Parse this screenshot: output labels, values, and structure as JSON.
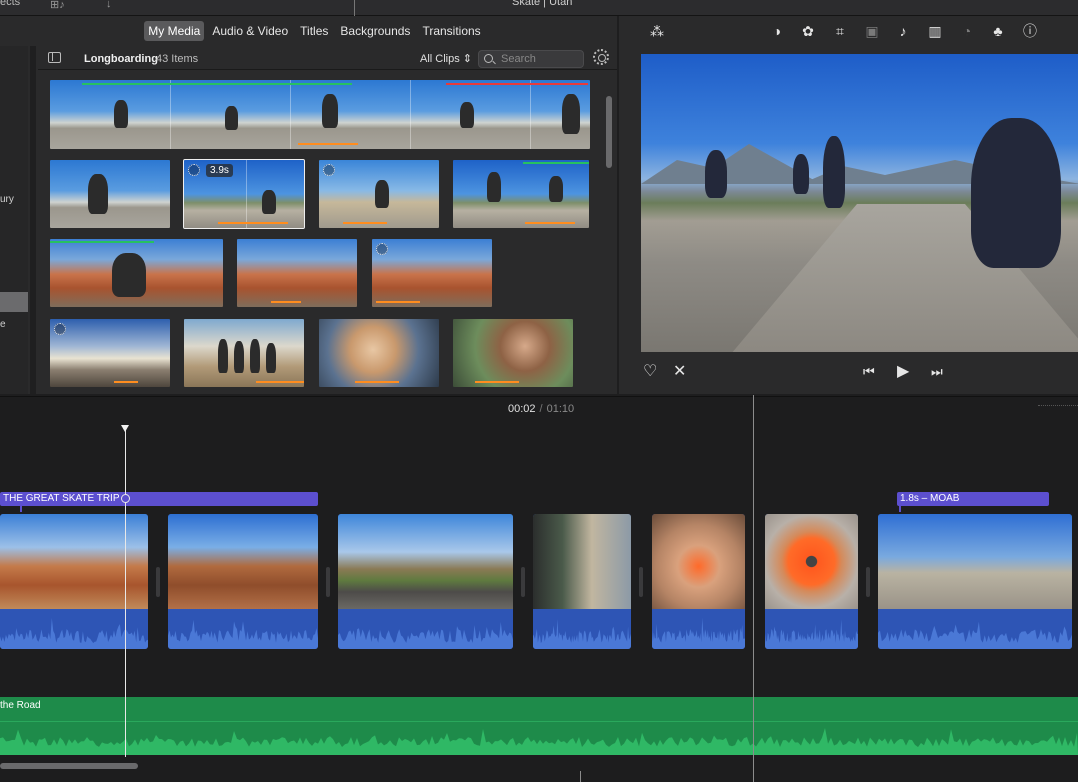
{
  "topbar": {
    "left_fragment": "ects",
    "project_title": "Skate | Utah"
  },
  "browser": {
    "tabs": [
      {
        "label": "My Media",
        "active": true
      },
      {
        "label": "Audio & Video",
        "active": false
      },
      {
        "label": "Titles",
        "active": false
      },
      {
        "label": "Backgrounds",
        "active": false
      },
      {
        "label": "Transitions",
        "active": false
      }
    ],
    "sidebar_fragments": [
      "ury",
      "e"
    ],
    "event_name": "Longboarding",
    "item_count": "43 Items",
    "clip_filter": "All Clips",
    "search_placeholder": "Search",
    "selected_clip_duration": "3.9s"
  },
  "viewer": {
    "toolbar_icons": [
      "magic-wand-icon",
      "color-balance-icon",
      "color-correction-icon",
      "crop-icon",
      "stabilization-icon",
      "volume-icon",
      "equalizer-icon",
      "speed-icon",
      "clip-filter-icon",
      "info-icon"
    ]
  },
  "timeline": {
    "current_time": "00:02",
    "separator": "/",
    "total_time": "01:10",
    "title_clips": [
      {
        "label": "THE GREAT SKATE TRIP"
      },
      {
        "label": "1.8s – MOAB"
      }
    ],
    "music_label": "the Road"
  },
  "colors": {
    "title_purple": "#5c4fcf",
    "audio_blue": "#2e55b5",
    "music_green": "#1e8b4a",
    "used_orange": "#ff8d1f",
    "favorite_green": "#27c160",
    "reject_red": "#e83a3a"
  }
}
